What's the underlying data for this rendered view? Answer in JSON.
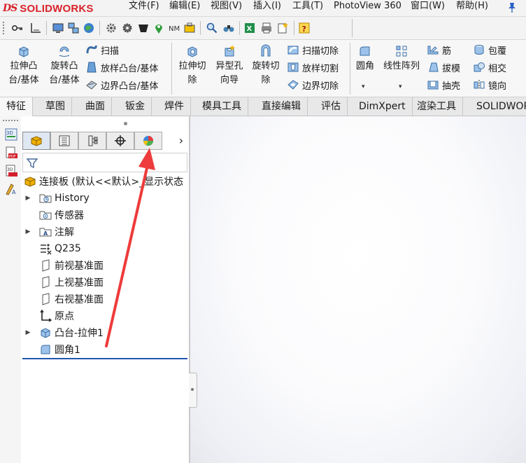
{
  "app": {
    "logo_prefix": "DS",
    "logo_text": "SOLIDWORKS"
  },
  "menu": [
    {
      "label": "文件(F)",
      "name": "menu-file"
    },
    {
      "label": "编辑(E)",
      "name": "menu-edit"
    },
    {
      "label": "视图(V)",
      "name": "menu-view"
    },
    {
      "label": "插入(I)",
      "name": "menu-insert"
    },
    {
      "label": "工具(T)",
      "name": "menu-tools"
    },
    {
      "label": "PhotoView 360",
      "name": "menu-photoview"
    },
    {
      "label": "窗口(W)",
      "name": "menu-window"
    },
    {
      "label": "帮助(H)",
      "name": "menu-help"
    }
  ],
  "ribbon": {
    "extrude_boss_l1": "拉伸凸",
    "extrude_boss_l2": "台/基体",
    "revolve_boss_l1": "旋转凸",
    "revolve_boss_l2": "台/基体",
    "sweep": "扫描",
    "loft_boss": "放样凸台/基体",
    "boundary_boss": "边界凸台/基体",
    "extrude_cut_l1": "拉伸切",
    "extrude_cut_l2": "除",
    "hole_wizard_l1": "异型孔",
    "hole_wizard_l2": "向导",
    "revolve_cut_l1": "旋转切",
    "revolve_cut_l2": "除",
    "swept_cut": "扫描切除",
    "lofted_cut": "放样切割",
    "boundary_cut": "边界切除",
    "fillet": "圆角",
    "linear_pattern": "线性阵列",
    "rib": "筋",
    "draft": "拔模",
    "shell": "抽壳",
    "wrap": "包覆",
    "intersect": "相交",
    "mirror": "镜向"
  },
  "tabs": [
    {
      "label": "特征",
      "name": "tab-features"
    },
    {
      "label": "草图",
      "name": "tab-sketch"
    },
    {
      "label": "曲面",
      "name": "tab-surfaces"
    },
    {
      "label": "钣金",
      "name": "tab-sheet-metal"
    },
    {
      "label": "焊件",
      "name": "tab-weldments"
    },
    {
      "label": "模具工具",
      "name": "tab-mold-tools"
    },
    {
      "label": "直接编辑",
      "name": "tab-direct-editing"
    },
    {
      "label": "评估",
      "name": "tab-evaluate"
    },
    {
      "label": "DimXpert",
      "name": "tab-dimxpert"
    },
    {
      "label": "渲染工具",
      "name": "tab-render-tools"
    },
    {
      "label": "SOLIDWORKS",
      "name": "tab-solidworks-addins"
    }
  ],
  "feature_tree": {
    "root_label": "连接板 (默认<<默认>_显示状态",
    "items": [
      {
        "label": "History",
        "icon": "history-folder-icon"
      },
      {
        "label": "传感器",
        "icon": "sensors-icon"
      },
      {
        "label": "注解",
        "icon": "annotations-icon"
      },
      {
        "label": "Q235",
        "icon": "material-icon"
      },
      {
        "label": "前视基准面",
        "icon": "plane-icon"
      },
      {
        "label": "上视基准面",
        "icon": "plane-icon"
      },
      {
        "label": "右视基准面",
        "icon": "plane-icon"
      },
      {
        "label": "原点",
        "icon": "origin-icon"
      },
      {
        "label": "凸台-拉伸1",
        "icon": "boss-extrude-icon"
      },
      {
        "label": "圆角1",
        "icon": "fillet-icon"
      }
    ]
  },
  "fm_tabs": [
    "feature-manager-tab",
    "property-manager-tab",
    "configuration-manager-tab",
    "dimxpert-manager-tab",
    "display-manager-tab"
  ],
  "colors": {
    "brand_red": "#d9232a",
    "annotation_arrow": "#ee3b3b",
    "selection_blue": "#1f57b0"
  }
}
